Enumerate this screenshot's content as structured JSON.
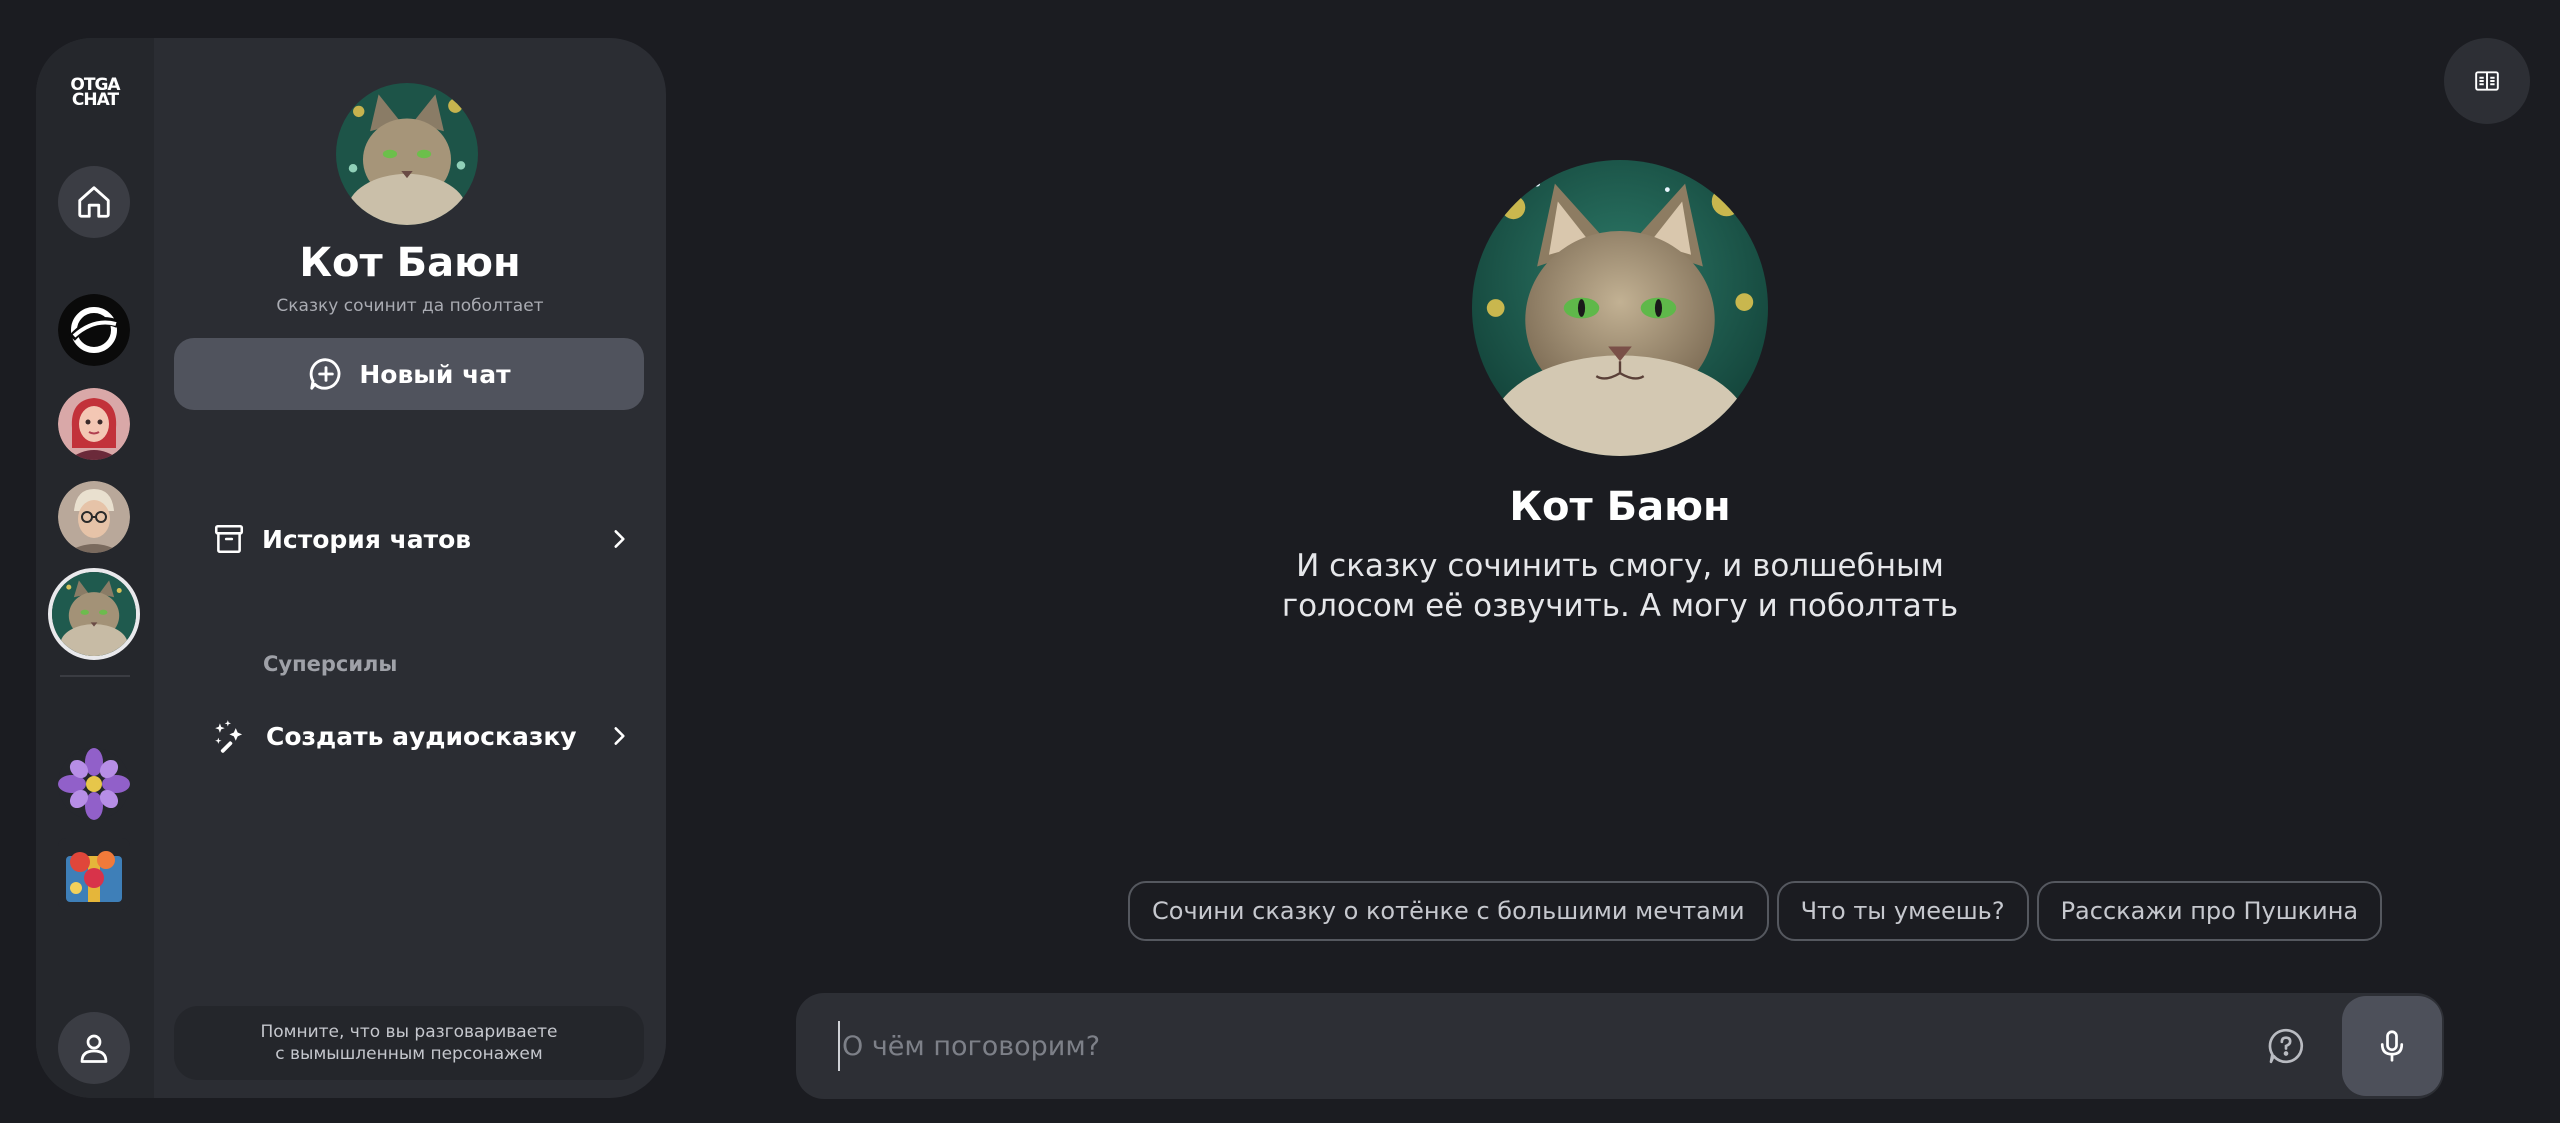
{
  "app": {
    "logo_line1": "OTGA",
    "logo_line2": "CHAT"
  },
  "rail": {
    "items": [
      "home-icon",
      "gpt-logo",
      "avatar-girl",
      "avatar-man-glasses",
      "avatar-cat-active",
      "avatar-flower",
      "avatar-gift"
    ],
    "user_icon": "user-icon"
  },
  "profile": {
    "name": "Кот Баюн",
    "subtitle": "Сказку сочинит да поболтает",
    "new_chat_label": "Новый чат"
  },
  "menu": {
    "history_label": "История чатов",
    "section_label": "Суперсилы",
    "audio_label": "Создать аудиосказку"
  },
  "disclaimer": "Помните, что вы разговариваете\nс вымышленным персонажем",
  "hero": {
    "name": "Кот Баюн",
    "description": "И сказку сочинить смогу, и волшебным\nголосом её озвучить. А могу и поболтать"
  },
  "suggestions": [
    "Сочини сказку о котёнке с большими мечтами",
    "Что ты умеешь?",
    "Расскажи про Пушкина"
  ],
  "input": {
    "placeholder": "О чём поговорим?",
    "value": ""
  },
  "colors": {
    "background": "#1b1c21",
    "panel": "#2b2d33",
    "button": "#50535d"
  }
}
